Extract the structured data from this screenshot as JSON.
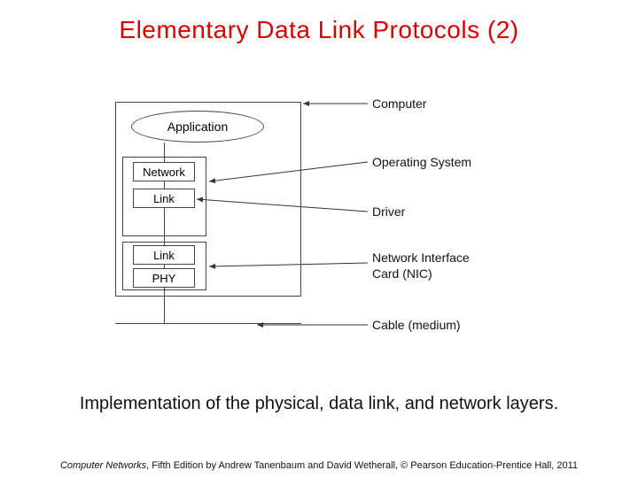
{
  "title": "Elementary Data Link Protocols (2)",
  "diagram": {
    "application": "Application",
    "layers": {
      "network": "Network",
      "link1": "Link",
      "link2": "Link",
      "phy": "PHY"
    },
    "callouts": {
      "computer": "Computer",
      "os": "Operating System",
      "driver": "Driver",
      "nic": "Network Interface\nCard (NIC)",
      "cable": "Cable (medium)"
    }
  },
  "caption": "Implementation of the physical, data link, and network layers.",
  "footer": {
    "book": "Computer Networks",
    "rest": ", Fifth Edition by Andrew Tanenbaum and David Wetherall, © Pearson Education-Prentice Hall, 2011"
  }
}
